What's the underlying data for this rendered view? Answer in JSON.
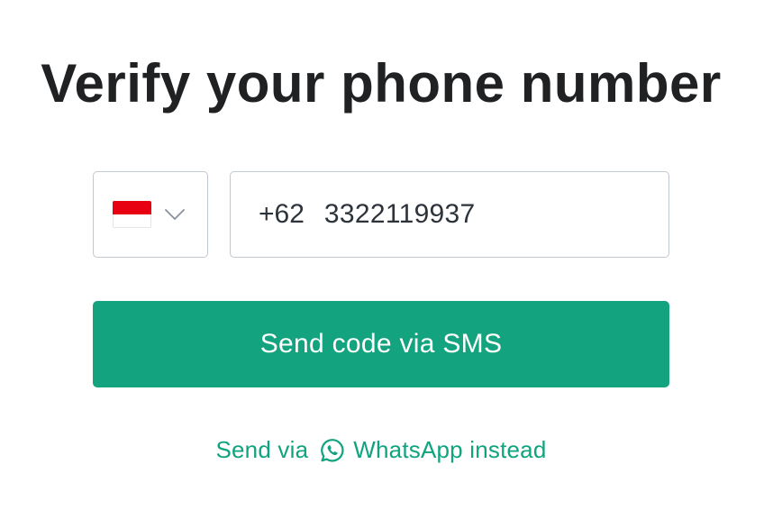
{
  "title": "Verify your phone number",
  "country": {
    "flag_icon": "indonesia-flag-icon",
    "flag_colors": {
      "top": "#e70011",
      "bottom": "#ffffff"
    },
    "chevron_icon": "chevron-down-icon"
  },
  "phone": {
    "dial_code": "+62",
    "number": "3322119937"
  },
  "send_sms_label": "Send code via SMS",
  "whatsapp": {
    "prefix": "Send via",
    "icon": "whatsapp-icon",
    "suffix": "WhatsApp instead"
  },
  "colors": {
    "accent": "#10a37f",
    "button": "#14a37f",
    "border": "#c2c8d0",
    "text": "#202123"
  }
}
